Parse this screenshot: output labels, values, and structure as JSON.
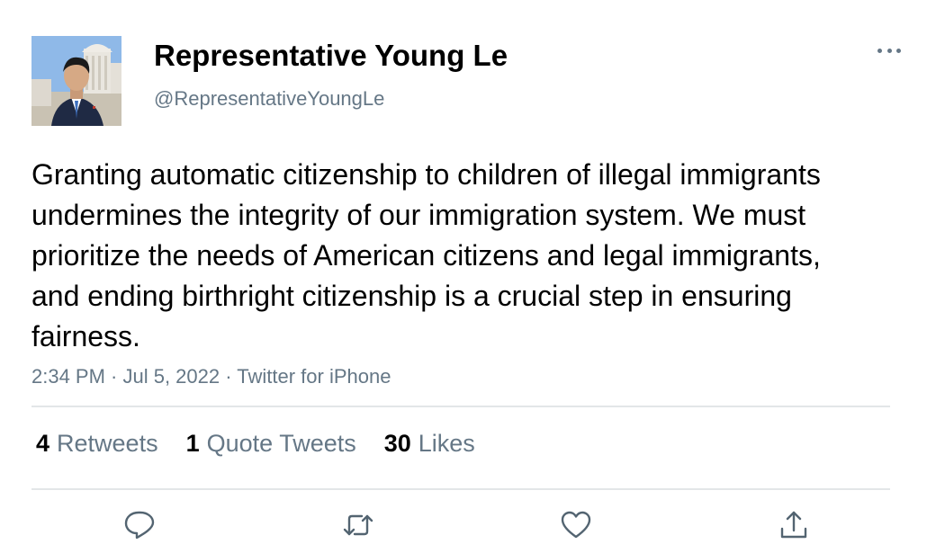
{
  "author": {
    "display_name": "Representative Young Le",
    "handle": "@RepresentativeYoungLe",
    "avatar_icon": "profile-photo"
  },
  "tweet": {
    "text": "Granting automatic citizenship to children of illegal immigrants undermines the integrity of our immigration system. We must prioritize the needs of American citizens and legal immigrants, and ending birthright citizenship is a crucial step in ensuring fairness.",
    "meta": "2:34 PM · Jul 5, 2022 · Twitter for iPhone"
  },
  "stats": {
    "retweets": {
      "count": "4",
      "label": "Retweets"
    },
    "quote_tweets": {
      "count": "1",
      "label": "Quote Tweets"
    },
    "likes": {
      "count": "30",
      "label": "Likes"
    }
  },
  "actions": [
    "reply-icon",
    "retweet-icon",
    "like-icon",
    "share-icon"
  ],
  "colors": {
    "text": "#000000",
    "secondary": "#657786",
    "divider": "#e3e6e8"
  }
}
